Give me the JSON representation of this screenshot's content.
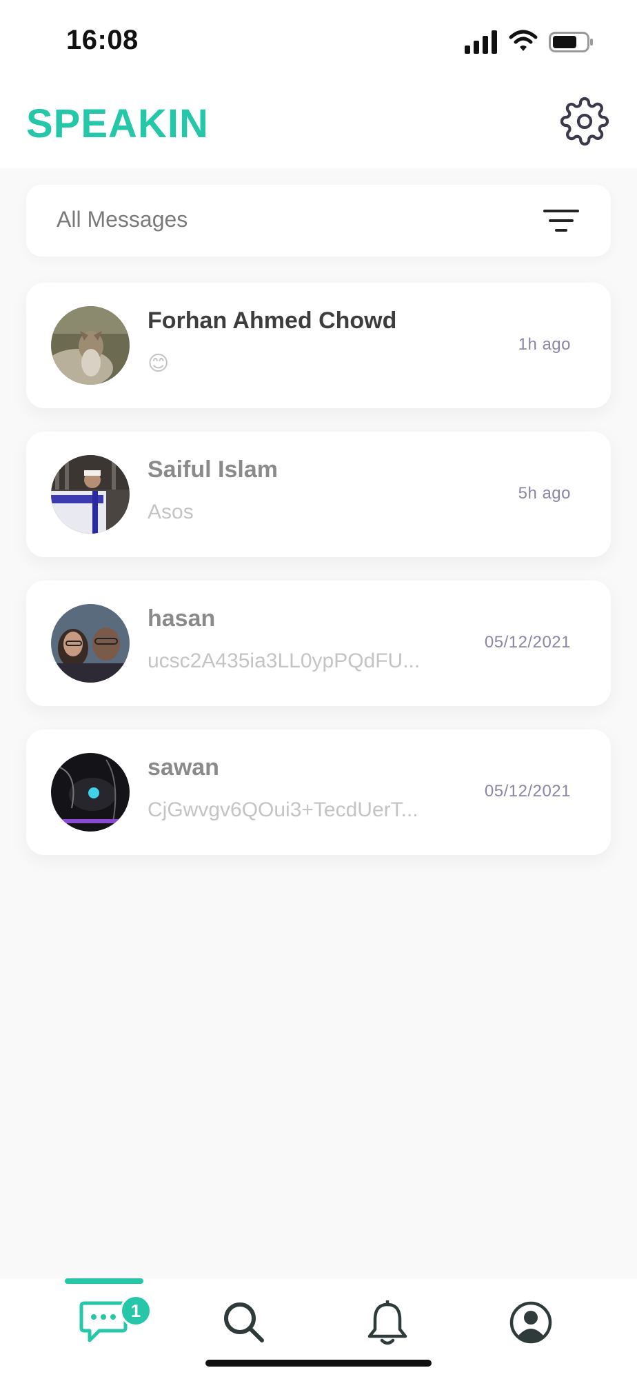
{
  "status_bar": {
    "time": "16:08"
  },
  "header": {
    "title": "SPEAKIN"
  },
  "filter": {
    "label": "All Messages"
  },
  "conversations": [
    {
      "name": "Forhan Ahmed Chowd",
      "preview": "😊",
      "time": "1h ago",
      "unread": true
    },
    {
      "name": "Saiful Islam",
      "preview": "Asos",
      "time": "5h ago",
      "unread": false
    },
    {
      "name": "hasan",
      "preview": "ucsc2A435ia3LL0ypPQdFU...",
      "time": "05/12/2021",
      "unread": false
    },
    {
      "name": "sawan",
      "preview": "CjGwvgv6QOui3+TecdUerT...",
      "time": "05/12/2021",
      "unread": false
    }
  ],
  "bottom_nav": {
    "items": [
      {
        "icon": "chat-icon",
        "active": true,
        "badge": "1"
      },
      {
        "icon": "search-icon",
        "active": false
      },
      {
        "icon": "bell-icon",
        "active": false
      },
      {
        "icon": "profile-icon",
        "active": false
      }
    ]
  },
  "colors": {
    "accent": "#26c6a8",
    "background": "#f9f9f9",
    "card": "#ffffff",
    "time_text": "#8a86a8",
    "icon_dark": "#2f3b3a"
  }
}
